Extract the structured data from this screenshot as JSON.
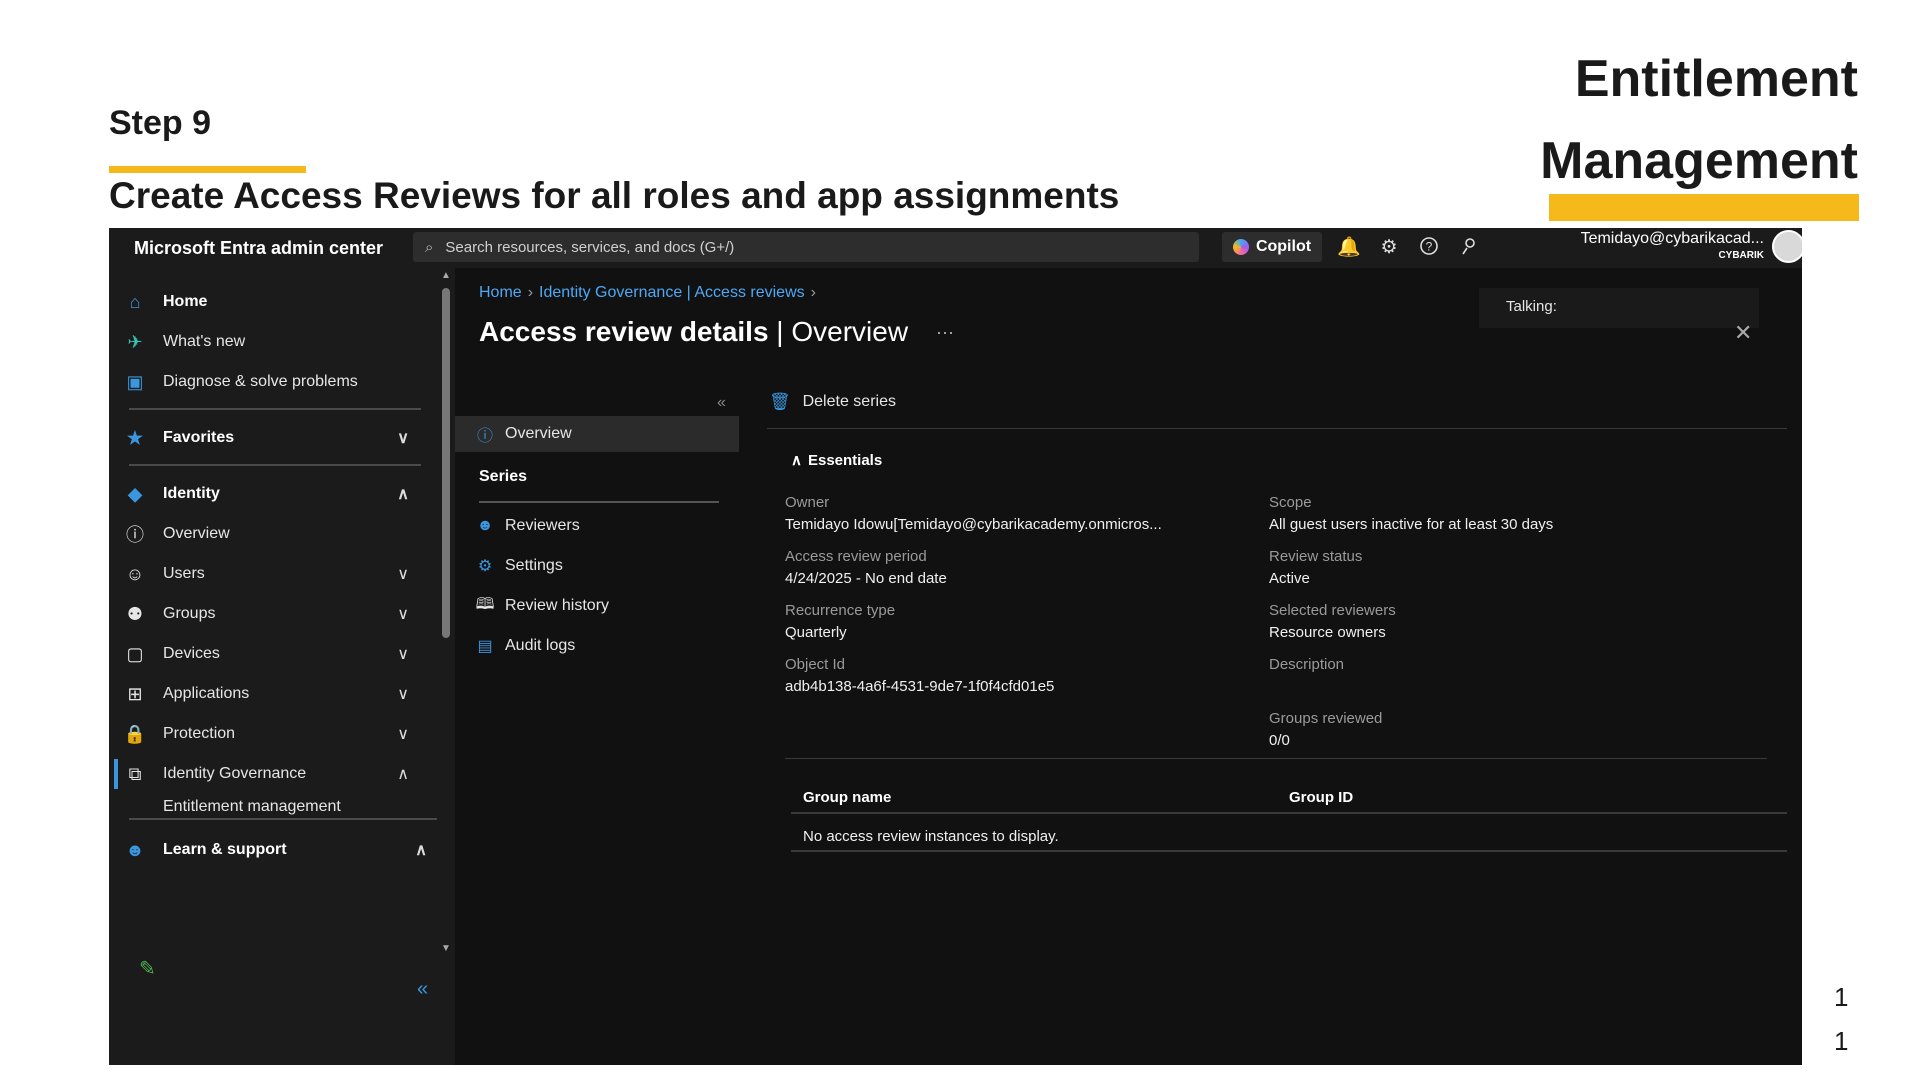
{
  "slide": {
    "step": "Step 9",
    "subtitle": "Create Access Reviews for all roles and app assignments",
    "title_line1": "Entitlement",
    "title_line2": "Management",
    "page_numbers": [
      "1",
      "1"
    ],
    "accent_color": "#f5b91c"
  },
  "topbar": {
    "brand": "Microsoft Entra admin center",
    "search_placeholder": "Search resources, services, and docs (G+/)",
    "copilot_label": "Copilot",
    "icons": [
      "bell-icon",
      "gear-icon",
      "help-icon",
      "feedback-icon"
    ],
    "user_name": "Temidayo@cybarikacad...",
    "user_org": "CYBARIK"
  },
  "leftnav": {
    "items": [
      {
        "label": "Home",
        "icon": "home-icon"
      },
      {
        "label": "What's new",
        "icon": "rocket-icon"
      },
      {
        "label": "Diagnose & solve problems",
        "icon": "diagnose-icon"
      },
      {
        "label": "Favorites",
        "icon": "star-icon"
      },
      {
        "label": "Identity",
        "icon": "identity-icon"
      },
      {
        "label": "Overview",
        "icon": "info-icon"
      },
      {
        "label": "Users",
        "icon": "user-icon"
      },
      {
        "label": "Groups",
        "icon": "groups-icon"
      },
      {
        "label": "Devices",
        "icon": "devices-icon"
      },
      {
        "label": "Applications",
        "icon": "apps-icon"
      },
      {
        "label": "Protection",
        "icon": "lock-icon"
      },
      {
        "label": "Identity Governance",
        "icon": "governance-icon"
      },
      {
        "label": "Entitlement management",
        "icon": ""
      },
      {
        "label": "Learn & support",
        "icon": "learn-icon"
      }
    ]
  },
  "main": {
    "breadcrumb": [
      "Home",
      "Identity Governance | Access reviews"
    ],
    "title_strong": "Access review details",
    "title_rest": " | Overview",
    "talking_label": "Talking:",
    "subnav": {
      "overview": "Overview",
      "series_heading": "Series",
      "reviewers": "Reviewers",
      "settings": "Settings",
      "review_history": "Review history",
      "audit_logs": "Audit logs"
    },
    "command": "Delete series",
    "essentials_label": "Essentials",
    "fields": {
      "owner_label": "Owner",
      "owner_value": "Temidayo Idowu[Temidayo@cybarikacademy.onmicros...",
      "period_label": "Access review period",
      "period_value": "4/24/2025 - No end date",
      "recurrence_label": "Recurrence type",
      "recurrence_value": "Quarterly",
      "object_label": "Object Id",
      "object_value": "adb4b138-4a6f-4531-9de7-1f0f4cfd01e5",
      "scope_label": "Scope",
      "scope_value": "All guest users inactive for at least 30 days",
      "status_label": "Review status",
      "status_value": "Active",
      "reviewers_label": "Selected reviewers",
      "reviewers_value": "Resource owners",
      "description_label": "Description",
      "groups_label": "Groups reviewed",
      "groups_value": "0/0"
    },
    "table": {
      "headers": [
        "Group name",
        "Group ID"
      ],
      "empty_message": "No access review instances to display."
    }
  }
}
